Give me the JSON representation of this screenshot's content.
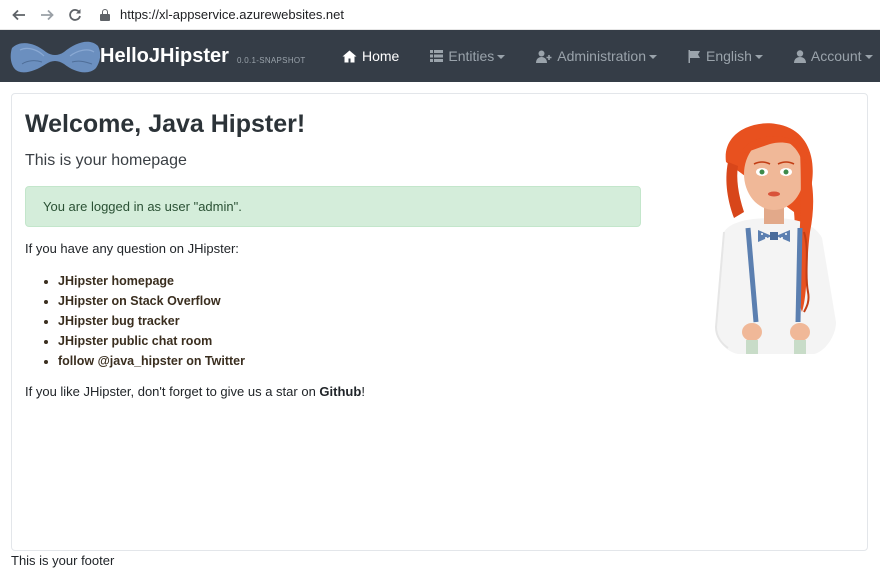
{
  "browser": {
    "url": "https://xl-appservice.azurewebsites.net"
  },
  "navbar": {
    "brand": "HelloJHipster",
    "version": "0.0.1-SNAPSHOT",
    "items": [
      {
        "label": "Home",
        "icon": "home-icon"
      },
      {
        "label": "Entities",
        "icon": "th-list-icon"
      },
      {
        "label": "Administration",
        "icon": "user-plus-icon"
      },
      {
        "label": "English",
        "icon": "flag-icon"
      },
      {
        "label": "Account",
        "icon": "user-icon"
      }
    ]
  },
  "main": {
    "title": "Welcome, Java Hipster!",
    "subtitle": "This is your homepage",
    "alert": "You are logged in as user \"admin\".",
    "question": "If you have any question on JHipster:",
    "links": [
      "JHipster homepage",
      "JHipster on Stack Overflow",
      "JHipster bug tracker",
      "JHipster public chat room",
      "follow @java_hipster on Twitter"
    ],
    "star_prefix": "If you like JHipster, don't forget to give us a star on ",
    "star_link": "Github",
    "star_suffix": "!"
  },
  "footer": "This is your footer",
  "colors": {
    "navbar_bg": "#353d47",
    "alert_bg": "#d4edda",
    "hair": "#e8511f"
  }
}
